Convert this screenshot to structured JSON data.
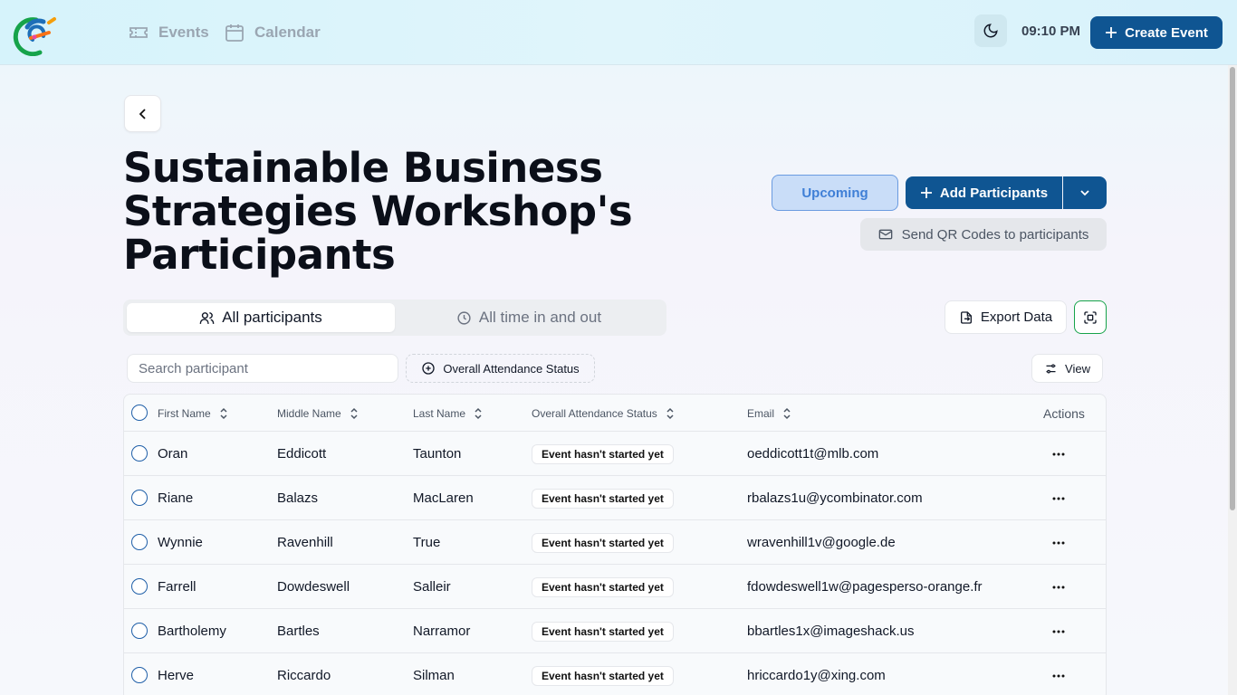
{
  "nav": {
    "items": [
      {
        "label": "Events",
        "icon": "ticket-icon"
      },
      {
        "label": "Calendar",
        "icon": "calendar-icon"
      }
    ],
    "time": "09:10 PM",
    "create_label": "Create Event"
  },
  "page": {
    "title": "Sustainable Business Strategies Workshop's Participants",
    "status": "Upcoming",
    "add_participants_label": "Add Participants",
    "send_qr_label": "Send QR Codes to participants",
    "export_label": "Export Data"
  },
  "tabs": [
    {
      "label": "All participants",
      "active": true
    },
    {
      "label": "All time in and out",
      "active": false
    }
  ],
  "toolbar": {
    "search_placeholder": "Search participant",
    "filter_label": "Overall Attendance Status",
    "view_label": "View"
  },
  "table": {
    "columns": [
      "First Name",
      "Middle Name",
      "Last Name",
      "Overall Attendance Status",
      "Email",
      "Actions"
    ],
    "rows": [
      {
        "first": "Oran",
        "middle": "Eddicott",
        "last": "Taunton",
        "status": "Event hasn't started yet",
        "email": "oeddicott1t@mlb.com"
      },
      {
        "first": "Riane",
        "middle": "Balazs",
        "last": "MacLaren",
        "status": "Event hasn't started yet",
        "email": "rbalazs1u@ycombinator.com"
      },
      {
        "first": "Wynnie",
        "middle": "Ravenhill",
        "last": "True",
        "status": "Event hasn't started yet",
        "email": "wravenhill1v@google.de"
      },
      {
        "first": "Farrell",
        "middle": "Dowdeswell",
        "last": "Salleir",
        "status": "Event hasn't started yet",
        "email": "fdowdeswell1w@pagesperso-orange.fr"
      },
      {
        "first": "Bartholemy",
        "middle": "Bartles",
        "last": "Narramor",
        "status": "Event hasn't started yet",
        "email": "bbartles1x@imageshack.us"
      },
      {
        "first": "Herve",
        "middle": "Riccardo",
        "last": "Silman",
        "status": "Event hasn't started yet",
        "email": "hriccardo1y@xing.com"
      }
    ]
  },
  "colors": {
    "primary": "#0f5592",
    "upcoming_bg": "#c9ddf8",
    "upcoming_text": "#3f7fd6",
    "scan_border": "#16a34a"
  }
}
